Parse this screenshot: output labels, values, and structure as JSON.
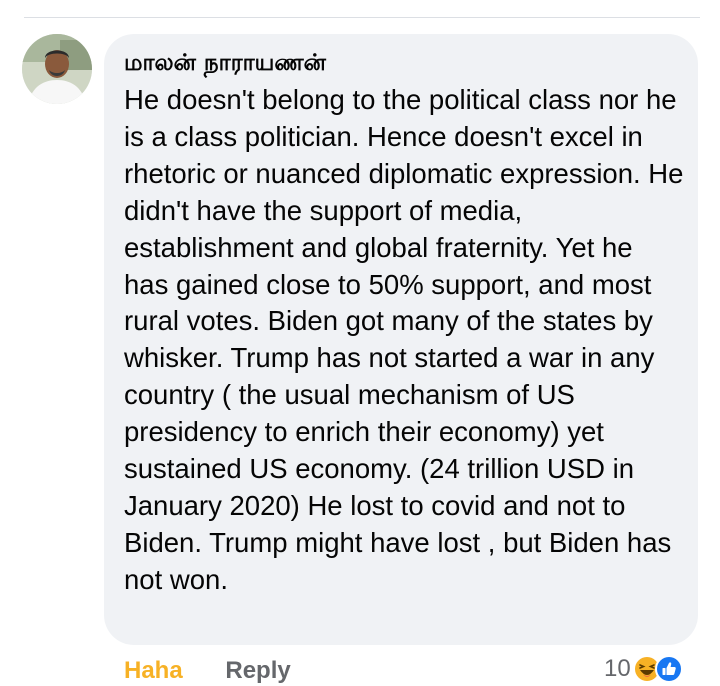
{
  "comment": {
    "author": "மாலன் நாராயணன்",
    "text": "He doesn't belong to the political class nor he is a class politician. Hence doesn't excel in rhetoric or nuanced diplomatic expression. He didn't have the support of media, establishment and global fraternity. Yet he has gained close to 50% support, and most rural votes. Biden got many of the states by whisker. Trump has not started a war in any country ( the usual mechanism of US presidency to enrich their economy) yet sustained US economy. (24 trillion USD in January 2020) He lost to covid and not to Biden. Trump might have lost , but Biden has not won."
  },
  "actions": {
    "reaction_label": "Haha",
    "reply_label": "Reply"
  },
  "reactions": {
    "count": "10",
    "icons": [
      "haha-emoji-icon",
      "like-thumb-icon"
    ]
  },
  "colors": {
    "bubble": "#f0f2f5",
    "text": "#050505",
    "haha_active": "#f7b125",
    "secondary": "#65676b",
    "like_blue": "#1877f2"
  }
}
